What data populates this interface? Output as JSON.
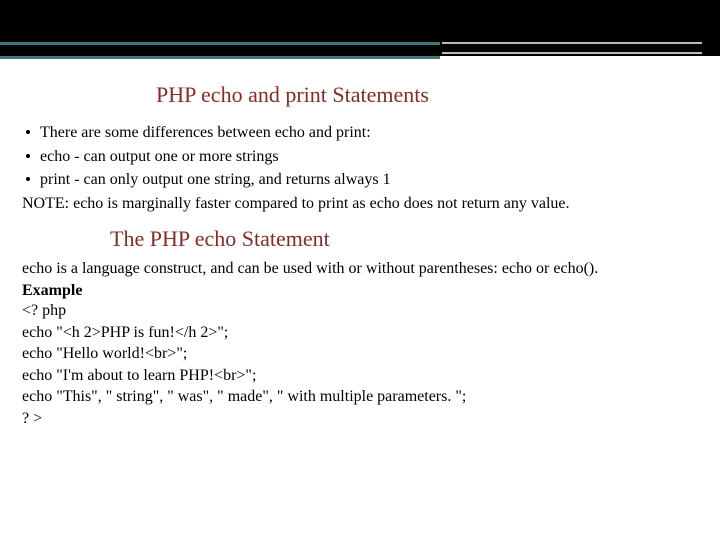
{
  "title": "PHP echo and print Statements",
  "bullets": [
    "There are some differences between echo and print:",
    "echo - can output one or more strings",
    "print - can only output one string, and returns always 1"
  ],
  "note": "NOTE: echo is marginally faster compared to print as echo does not return any value.",
  "subheading": "The PHP echo Statement",
  "paragraph": "echo is a language construct, and can be used with or without parentheses: echo or echo().",
  "example_label": "Example",
  "code": [
    "<? php",
    "echo \"<h 2>PHP is fun!</h 2>\";",
    "echo \"Hello world!<br>\";",
    "echo \"I'm about to learn PHP!<br>\";",
    "echo \"This\", \" string\", \" was\", \" made\", \" with multiple parameters. \";",
    "? >"
  ]
}
